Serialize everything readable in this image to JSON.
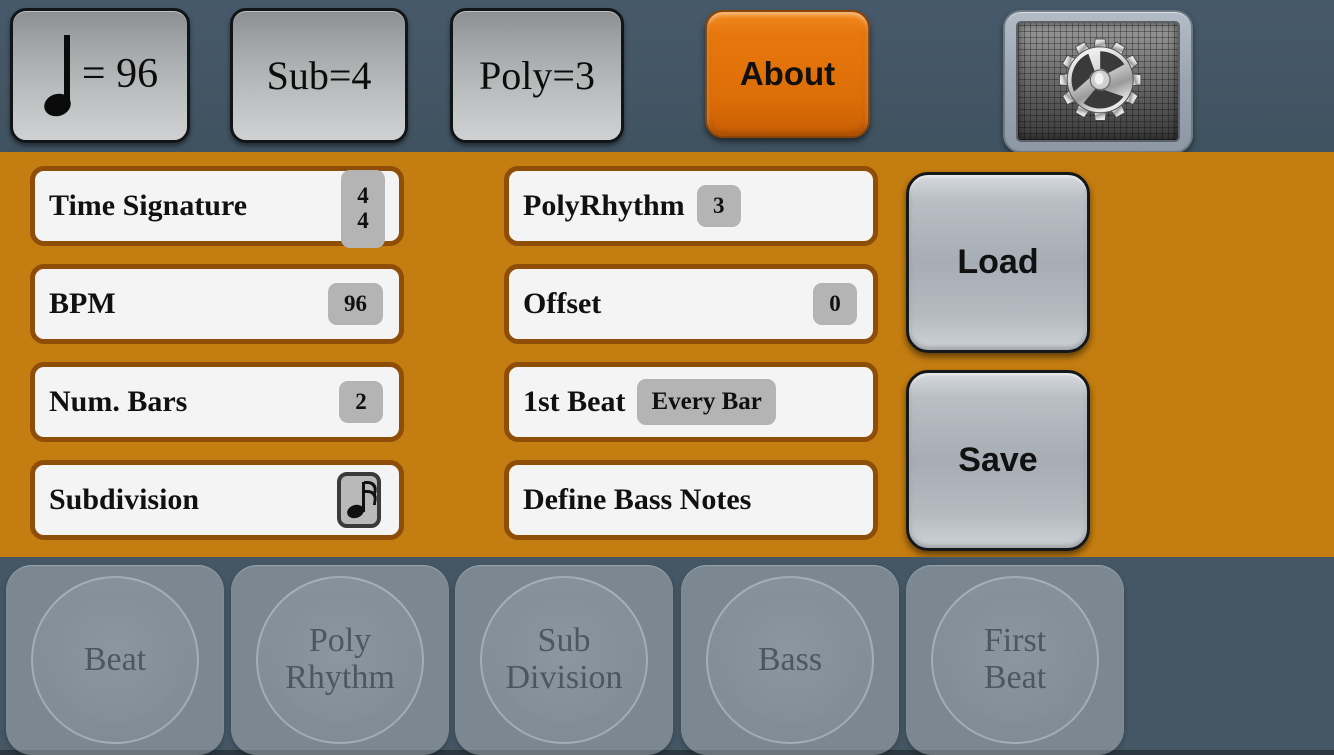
{
  "colors": {
    "background": "#455765",
    "panel_orange": "#c47d10",
    "row_border_brown": "#8f4e08",
    "accent_orange": "#e8770d",
    "row_fill": "#f4f4f4",
    "value_pill": "#b4b4b4"
  },
  "topbar": {
    "tempo_button": {
      "icon": "quarter-note-icon",
      "text": "= 96",
      "bpm": "96"
    },
    "sub_button": {
      "label": "Sub=4"
    },
    "poly_button": {
      "label": "Poly=3"
    },
    "about_button": {
      "label": "About"
    },
    "settings_button": {
      "icon": "gear-icon"
    }
  },
  "panel": {
    "left_rows": [
      {
        "label": "Time Signature",
        "value": "4",
        "value2": "4",
        "kind": "stacked"
      },
      {
        "label": "BPM",
        "value": "96",
        "kind": "pill"
      },
      {
        "label": "Num. Bars",
        "value": "2",
        "kind": "pill"
      },
      {
        "label": "Subdivision",
        "value": "",
        "kind": "note",
        "icon": "sixteenth-note-icon"
      }
    ],
    "right_rows": [
      {
        "label": "PolyRhythm",
        "value": "3",
        "kind": "pill"
      },
      {
        "label": "Offset",
        "value": "0",
        "kind": "pill"
      },
      {
        "label": "1st Beat",
        "value": "Every Bar",
        "kind": "pill-wide"
      },
      {
        "label": "Define Bass Notes",
        "value": "",
        "kind": "none"
      }
    ],
    "load_button": {
      "label": "Load"
    },
    "save_button": {
      "label": "Save"
    }
  },
  "bottombar": {
    "pads": [
      {
        "label": "Beat"
      },
      {
        "label": "Poly\nRhythm"
      },
      {
        "label": "Sub\nDivision"
      },
      {
        "label": "Bass"
      },
      {
        "label": "First\nBeat"
      }
    ]
  }
}
